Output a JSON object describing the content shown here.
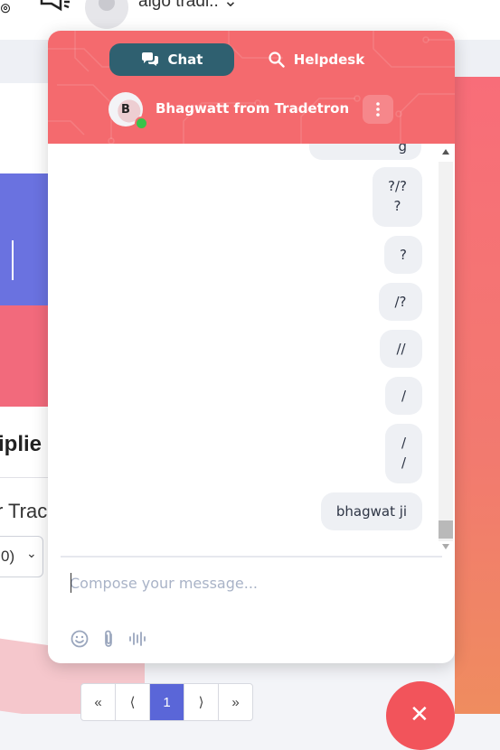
{
  "background": {
    "username": "algo tradi..",
    "username_chevron": "⌄",
    "heading_fragment": "iplie",
    "subheading_fragment": "r Trac",
    "select_value": "0)",
    "select_chevron": "⌄",
    "pagination": [
      "«",
      "⟨",
      "1",
      "⟩",
      "»"
    ],
    "close_glyph": "✕"
  },
  "chat_widget": {
    "tabs": [
      {
        "label": "Chat",
        "icon": "chat-bubbles-icon",
        "active": true
      },
      {
        "label": "Helpdesk",
        "icon": "search-icon",
        "active": false
      }
    ],
    "agent": {
      "initial": "B",
      "name": "Bhagwatt from Tradetron",
      "status": "online"
    },
    "messages": [
      {
        "text": "g"
      },
      {
        "text": "?/?\n?"
      },
      {
        "text": "?"
      },
      {
        "text": "/?"
      },
      {
        "text": "//"
      },
      {
        "text": "/"
      },
      {
        "text": "/\n/"
      },
      {
        "text": "bhagwat ji"
      }
    ],
    "composer": {
      "placeholder": "Compose your message..."
    },
    "toolbar": [
      "emoji-icon",
      "attachment-icon",
      "voice-icon"
    ]
  },
  "colors": {
    "header": "#f46a6e",
    "chat_tab": "#2f6070",
    "bubble": "#eef0f4",
    "online": "#39c24a",
    "page_accent": "#6a72e0"
  }
}
